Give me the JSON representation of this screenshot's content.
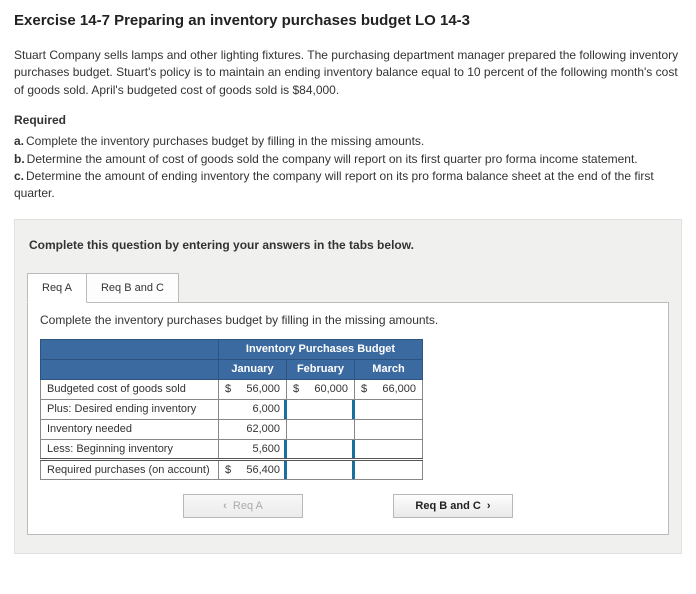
{
  "title": "Exercise 14-7 Preparing an inventory purchases budget LO 14-3",
  "intro": "Stuart Company sells lamps and other lighting fixtures. The purchasing department manager prepared the following inventory purchases budget. Stuart's policy is to maintain an ending inventory balance equal to 10 percent of the following month's cost of goods sold. April's budgeted cost of goods sold is $84,000.",
  "required_label": "Required",
  "required": {
    "a": {
      "lbl": "a.",
      "text": "Complete the inventory purchases budget by filling in the missing amounts."
    },
    "b": {
      "lbl": "b.",
      "text": "Determine the amount of cost of goods sold the company will report on its first quarter pro forma income statement."
    },
    "c": {
      "lbl": "c.",
      "text": "Determine the amount of ending inventory the company will report on its pro forma balance sheet at the end of the first quarter."
    }
  },
  "panel_instruction": "Complete this question by entering your answers in the tabs below.",
  "tabs": {
    "a": "Req A",
    "bc": "Req B and C"
  },
  "tab_sub": "Complete the inventory purchases budget by filling in the missing amounts.",
  "table": {
    "title": "Inventory Purchases Budget",
    "cols": {
      "jan": "January",
      "feb": "February",
      "mar": "March"
    },
    "rows": {
      "cogs": {
        "label": "Budgeted cost of goods sold",
        "jan_cur": "$",
        "jan": "56,000",
        "feb_cur": "$",
        "feb": "60,000",
        "mar_cur": "$",
        "mar": "66,000"
      },
      "dei": {
        "label": "Plus: Desired ending inventory",
        "jan": "6,000",
        "feb": "",
        "mar": ""
      },
      "need": {
        "label": "Inventory needed",
        "jan": "62,000",
        "feb": "",
        "mar": ""
      },
      "begin": {
        "label": "Less: Beginning inventory",
        "jan": "5,600",
        "feb": "",
        "mar": ""
      },
      "reqp": {
        "label": "Required purchases (on account)",
        "jan_cur": "$",
        "jan": "56,400",
        "feb": "",
        "mar": ""
      }
    }
  },
  "nav": {
    "prev_chev": "‹",
    "prev": "Req A",
    "next": "Req B and C",
    "next_chev": "›"
  }
}
